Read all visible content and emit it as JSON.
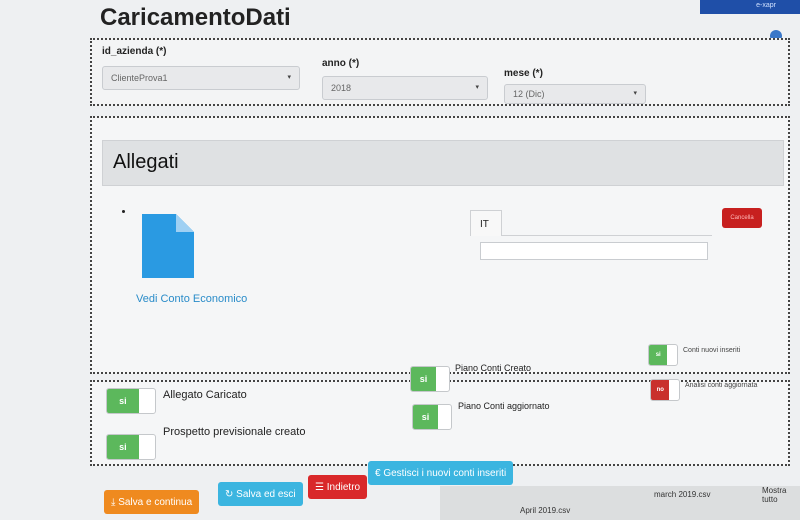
{
  "app": {
    "title": "CaricamentoDati",
    "topbar_text": "e-xapr"
  },
  "filters": {
    "azienda": {
      "label": "id_azienda (*)",
      "value": "ClienteProva1"
    },
    "anno": {
      "label": "anno (*)",
      "value": "2018"
    },
    "mese": {
      "label": "mese (*)",
      "value": "12 (Dic)"
    }
  },
  "attachments": {
    "heading": "Allegati",
    "document_icon": "document-icon",
    "link_text": "Vedi Conto Economico",
    "tab_label": "IT",
    "red_button_label": "Cancella"
  },
  "flags": {
    "allegato": {
      "toggle": "si",
      "label": "Allegato Caricato"
    },
    "prospetto": {
      "toggle": "si",
      "label": "Prospetto previsionale creato"
    },
    "piano_creato": {
      "toggle": "si",
      "label": "Piano Conti Creato"
    },
    "piano_aggiornato": {
      "toggle": "si",
      "label": "Piano Conti aggiornato"
    },
    "conti_nuovi": {
      "toggle": "si",
      "label": "Conti nuovi inseriti"
    },
    "analisi_conti": {
      "toggle": "no",
      "label": "Analisi conti aggiornata"
    }
  },
  "actions": {
    "save_continue": "Salva e continua",
    "save_exit": "Salva ed esci",
    "back": "Indietro",
    "manage_accounts": "Gestisci i nuovi conti inseriti"
  },
  "downloads": {
    "file1": "April 2019.csv",
    "file2": "march 2019.csv",
    "more": "Mostra tutto"
  },
  "colors": {
    "green": "#5cb85c",
    "red": "#c9302c",
    "orange": "#ef8a1f",
    "cyan": "#3bb5e0",
    "doc_blue": "#2a9ae2"
  }
}
